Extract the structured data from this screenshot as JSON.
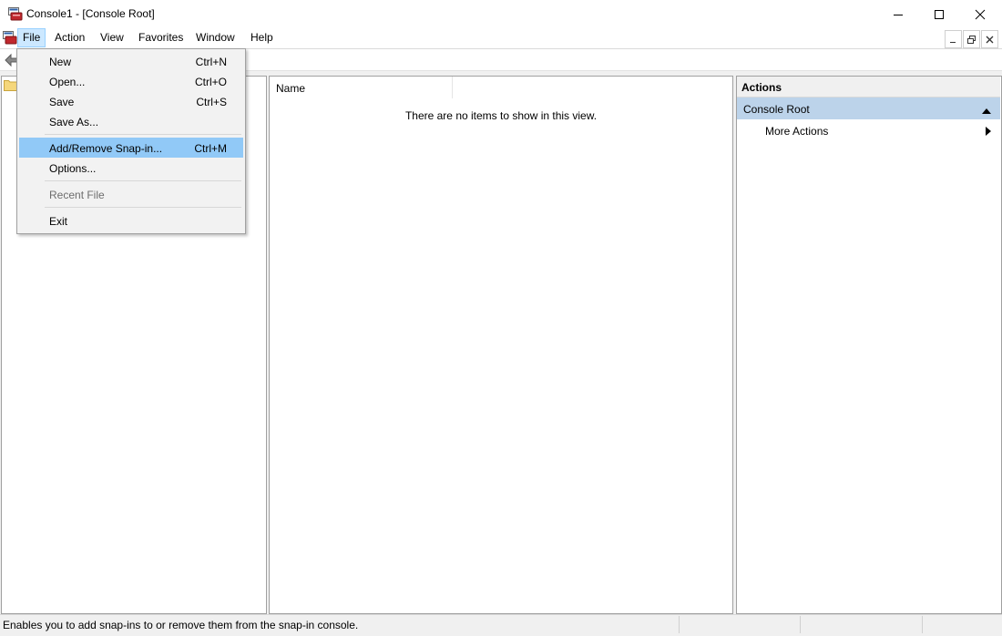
{
  "window": {
    "title": "Console1 - [Console Root]",
    "icons": {
      "app": "mmc-console-icon",
      "minimize": "minimize-icon",
      "maximize": "maximize-icon",
      "close": "close-icon"
    }
  },
  "menubar": {
    "items": [
      "File",
      "Action",
      "View",
      "Favorites",
      "Window",
      "Help"
    ],
    "active": "File"
  },
  "file_menu": {
    "items": [
      {
        "label": "New",
        "shortcut": "Ctrl+N"
      },
      {
        "label": "Open...",
        "shortcut": "Ctrl+O"
      },
      {
        "label": "Save",
        "shortcut": "Ctrl+S"
      },
      {
        "label": "Save As...",
        "shortcut": ""
      },
      {
        "label": "Add/Remove Snap-in...",
        "shortcut": "Ctrl+M",
        "highlighted": true
      },
      {
        "label": "Options...",
        "shortcut": ""
      },
      {
        "label": "Recent File",
        "shortcut": "",
        "disabled": true
      },
      {
        "label": "Exit",
        "shortcut": ""
      }
    ]
  },
  "list_view": {
    "columns": [
      "Name"
    ],
    "empty_message": "There are no items to show in this view."
  },
  "actions_pane": {
    "header": "Actions",
    "section": "Console Root",
    "items": [
      "More Actions"
    ]
  },
  "statusbar": {
    "text": "Enables you to add snap-ins to or remove them from the snap-in console."
  },
  "colors": {
    "highlight": "#91c9f7",
    "menu_active": "#cce8ff",
    "section_bar": "#bcd3ea",
    "menu_bg": "#f2f2f2"
  }
}
